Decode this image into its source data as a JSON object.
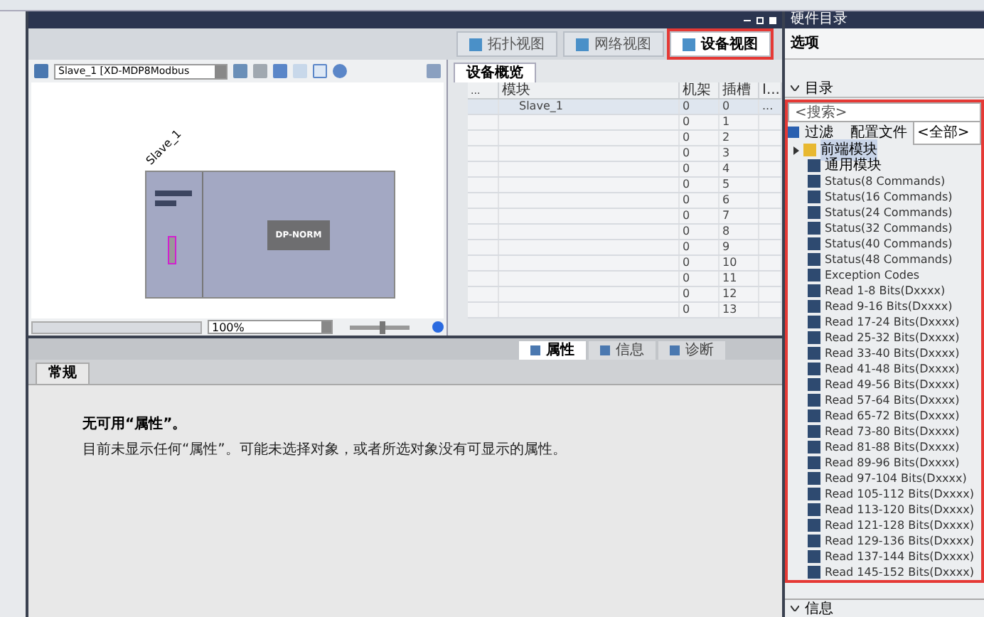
{
  "main_window": {
    "view_tabs": [
      {
        "label": "拓扑视图",
        "selected": false
      },
      {
        "label": "网络视图",
        "selected": false
      },
      {
        "label": "设备视图",
        "selected": true
      }
    ],
    "device_select": "Slave_1 [XD-MDP8Modbus",
    "canvas": {
      "device_label": "Slave_1",
      "module_label": "DP-NORM"
    },
    "zoom": "100%",
    "zoom_slider": {
      "level": 0.55
    },
    "overview": {
      "tab": "设备概览",
      "columns": [
        "...",
        "模块",
        "机架",
        "插槽",
        "I..."
      ],
      "rows": [
        {
          "cells": [
            "",
            "Slave_1",
            "0",
            "0",
            "..."
          ],
          "selected": true
        },
        {
          "cells": [
            "",
            "",
            "0",
            "1",
            ""
          ],
          "selected": false
        },
        {
          "cells": [
            "",
            "",
            "0",
            "2",
            ""
          ],
          "selected": false
        },
        {
          "cells": [
            "",
            "",
            "0",
            "3",
            ""
          ],
          "selected": false
        },
        {
          "cells": [
            "",
            "",
            "0",
            "4",
            ""
          ],
          "selected": false
        },
        {
          "cells": [
            "",
            "",
            "0",
            "5",
            ""
          ],
          "selected": false
        },
        {
          "cells": [
            "",
            "",
            "0",
            "6",
            ""
          ],
          "selected": false
        },
        {
          "cells": [
            "",
            "",
            "0",
            "7",
            ""
          ],
          "selected": false
        },
        {
          "cells": [
            "",
            "",
            "0",
            "8",
            ""
          ],
          "selected": false
        },
        {
          "cells": [
            "",
            "",
            "0",
            "9",
            ""
          ],
          "selected": false
        },
        {
          "cells": [
            "",
            "",
            "0",
            "10",
            ""
          ],
          "selected": false
        },
        {
          "cells": [
            "",
            "",
            "0",
            "11",
            ""
          ],
          "selected": false
        },
        {
          "cells": [
            "",
            "",
            "0",
            "12",
            ""
          ],
          "selected": false
        },
        {
          "cells": [
            "",
            "",
            "0",
            "13",
            ""
          ],
          "selected": false
        }
      ]
    }
  },
  "inspector": {
    "tabs": [
      {
        "label": "属性",
        "selected": true
      },
      {
        "label": "信息",
        "selected": false
      },
      {
        "label": "诊断",
        "selected": false
      }
    ],
    "subtab": "常规",
    "heading": "无可用“属性”。",
    "message": "目前未显示任何“属性”。可能未选择对象，或者所选对象没有可显示的属性。"
  },
  "catalog": {
    "title": "硬件目录",
    "options": "选项",
    "section": "目录",
    "search": {
      "placeholder": "<搜索>"
    },
    "filter": {
      "label": "过滤",
      "checked": true
    },
    "profile_label": "配置文件",
    "profile_value": "<全部>",
    "items": [
      {
        "label": "前端模块",
        "kind": "folder"
      },
      {
        "label": "通用模块",
        "kind": "group"
      },
      {
        "label": "Status(8 Commands)",
        "kind": "module"
      },
      {
        "label": "Status(16 Commands)",
        "kind": "module"
      },
      {
        "label": "Status(24 Commands)",
        "kind": "module"
      },
      {
        "label": "Status(32 Commands)",
        "kind": "module"
      },
      {
        "label": "Status(40 Commands)",
        "kind": "module"
      },
      {
        "label": "Status(48 Commands)",
        "kind": "module"
      },
      {
        "label": "Exception Codes",
        "kind": "module"
      },
      {
        "label": "Read 1-8 Bits(Dxxxx)",
        "kind": "module"
      },
      {
        "label": "Read 9-16 Bits(Dxxxx)",
        "kind": "module"
      },
      {
        "label": "Read 17-24 Bits(Dxxxx)",
        "kind": "module"
      },
      {
        "label": "Read 25-32 Bits(Dxxxx)",
        "kind": "module"
      },
      {
        "label": "Read 33-40 Bits(Dxxxx)",
        "kind": "module"
      },
      {
        "label": "Read 41-48 Bits(Dxxxx)",
        "kind": "module"
      },
      {
        "label": "Read 49-56 Bits(Dxxxx)",
        "kind": "module"
      },
      {
        "label": "Read 57-64 Bits(Dxxxx)",
        "kind": "module"
      },
      {
        "label": "Read 65-72 Bits(Dxxxx)",
        "kind": "module"
      },
      {
        "label": "Read 73-80 Bits(Dxxxx)",
        "kind": "module"
      },
      {
        "label": "Read 81-88 Bits(Dxxxx)",
        "kind": "module"
      },
      {
        "label": "Read 89-96 Bits(Dxxxx)",
        "kind": "module"
      },
      {
        "label": "Read 97-104 Bits(Dxxxx)",
        "kind": "module"
      },
      {
        "label": "Read 105-112 Bits(Dxxxx)",
        "kind": "module"
      },
      {
        "label": "Read 113-120 Bits(Dxxxx)",
        "kind": "module"
      },
      {
        "label": "Read 121-128 Bits(Dxxxx)",
        "kind": "module"
      },
      {
        "label": "Read 129-136 Bits(Dxxxx)",
        "kind": "module"
      },
      {
        "label": "Read 137-144 Bits(Dxxxx)",
        "kind": "module"
      },
      {
        "label": "Read 145-152 Bits(Dxxxx)",
        "kind": "module"
      }
    ],
    "info_section": "信息"
  }
}
